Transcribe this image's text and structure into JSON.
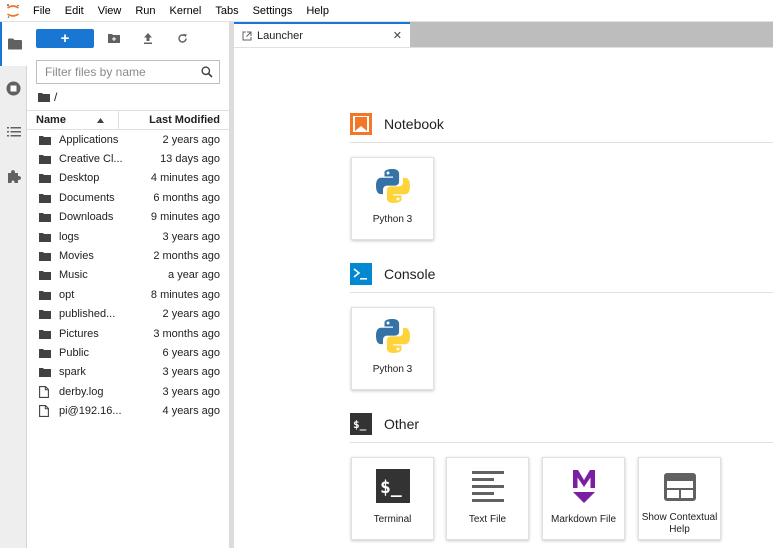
{
  "menubar": {
    "items": [
      "File",
      "Edit",
      "View",
      "Run",
      "Kernel",
      "Tabs",
      "Settings",
      "Help"
    ]
  },
  "activity": {
    "icons": [
      "folder-icon",
      "running-icon",
      "toc-icon",
      "extension-icon"
    ]
  },
  "filebrowser": {
    "new_label": "+",
    "search_placeholder": "Filter files by name",
    "path": "/",
    "columns": {
      "name": "Name",
      "modified": "Last Modified"
    },
    "files": [
      {
        "name": "Applications",
        "modified": "2 years ago",
        "kind": "folder"
      },
      {
        "name": "Creative Cl...",
        "modified": "13 days ago",
        "kind": "folder"
      },
      {
        "name": "Desktop",
        "modified": "4 minutes ago",
        "kind": "folder"
      },
      {
        "name": "Documents",
        "modified": "6 months ago",
        "kind": "folder"
      },
      {
        "name": "Downloads",
        "modified": "9 minutes ago",
        "kind": "folder"
      },
      {
        "name": "logs",
        "modified": "3 years ago",
        "kind": "folder"
      },
      {
        "name": "Movies",
        "modified": "2 months ago",
        "kind": "folder"
      },
      {
        "name": "Music",
        "modified": "a year ago",
        "kind": "folder"
      },
      {
        "name": "opt",
        "modified": "8 minutes ago",
        "kind": "folder"
      },
      {
        "name": "published...",
        "modified": "2 years ago",
        "kind": "folder"
      },
      {
        "name": "Pictures",
        "modified": "3 months ago",
        "kind": "folder"
      },
      {
        "name": "Public",
        "modified": "6 years ago",
        "kind": "folder"
      },
      {
        "name": "spark",
        "modified": "3 years ago",
        "kind": "folder"
      },
      {
        "name": "derby.log",
        "modified": "3 years ago",
        "kind": "file"
      },
      {
        "name": "pi@192.16...",
        "modified": "4 years ago",
        "kind": "file"
      }
    ]
  },
  "tab": {
    "label": "Launcher",
    "close": "✕"
  },
  "launcher": {
    "notebook": {
      "title": "Notebook",
      "cards": [
        {
          "label": "Python 3"
        }
      ]
    },
    "console": {
      "title": "Console",
      "cards": [
        {
          "label": "Python 3"
        }
      ]
    },
    "other": {
      "title": "Other",
      "cards": [
        {
          "label": "Terminal"
        },
        {
          "label": "Text File"
        },
        {
          "label": "Markdown File"
        },
        {
          "label": "Show Contextual Help"
        }
      ]
    }
  },
  "colors": {
    "accent": "#1976d2",
    "notebook": "#f37726",
    "console": "#0288d1",
    "markdown": "#7b1fa2",
    "icon_dark": "#616161"
  }
}
